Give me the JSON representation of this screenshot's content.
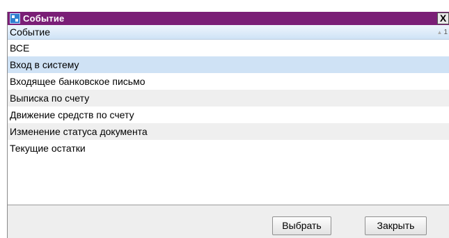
{
  "window": {
    "title": "Событие",
    "close_label": "X"
  },
  "list": {
    "column_header": "Событие",
    "sort_indicator": "1",
    "items": [
      "ВСЕ",
      "Вход в систему",
      "Входящее банковское письмо",
      "Выписка по счету",
      "Движение средств по счету",
      "Изменение статуса документа",
      "Текущие остатки"
    ],
    "selected_index": 1
  },
  "buttons": {
    "select_label": "Выбрать",
    "close_label": "Закрыть"
  },
  "colors": {
    "titlebar": "#7a1e76",
    "selection": "#cfe2f5",
    "alt_row": "#efefef"
  }
}
